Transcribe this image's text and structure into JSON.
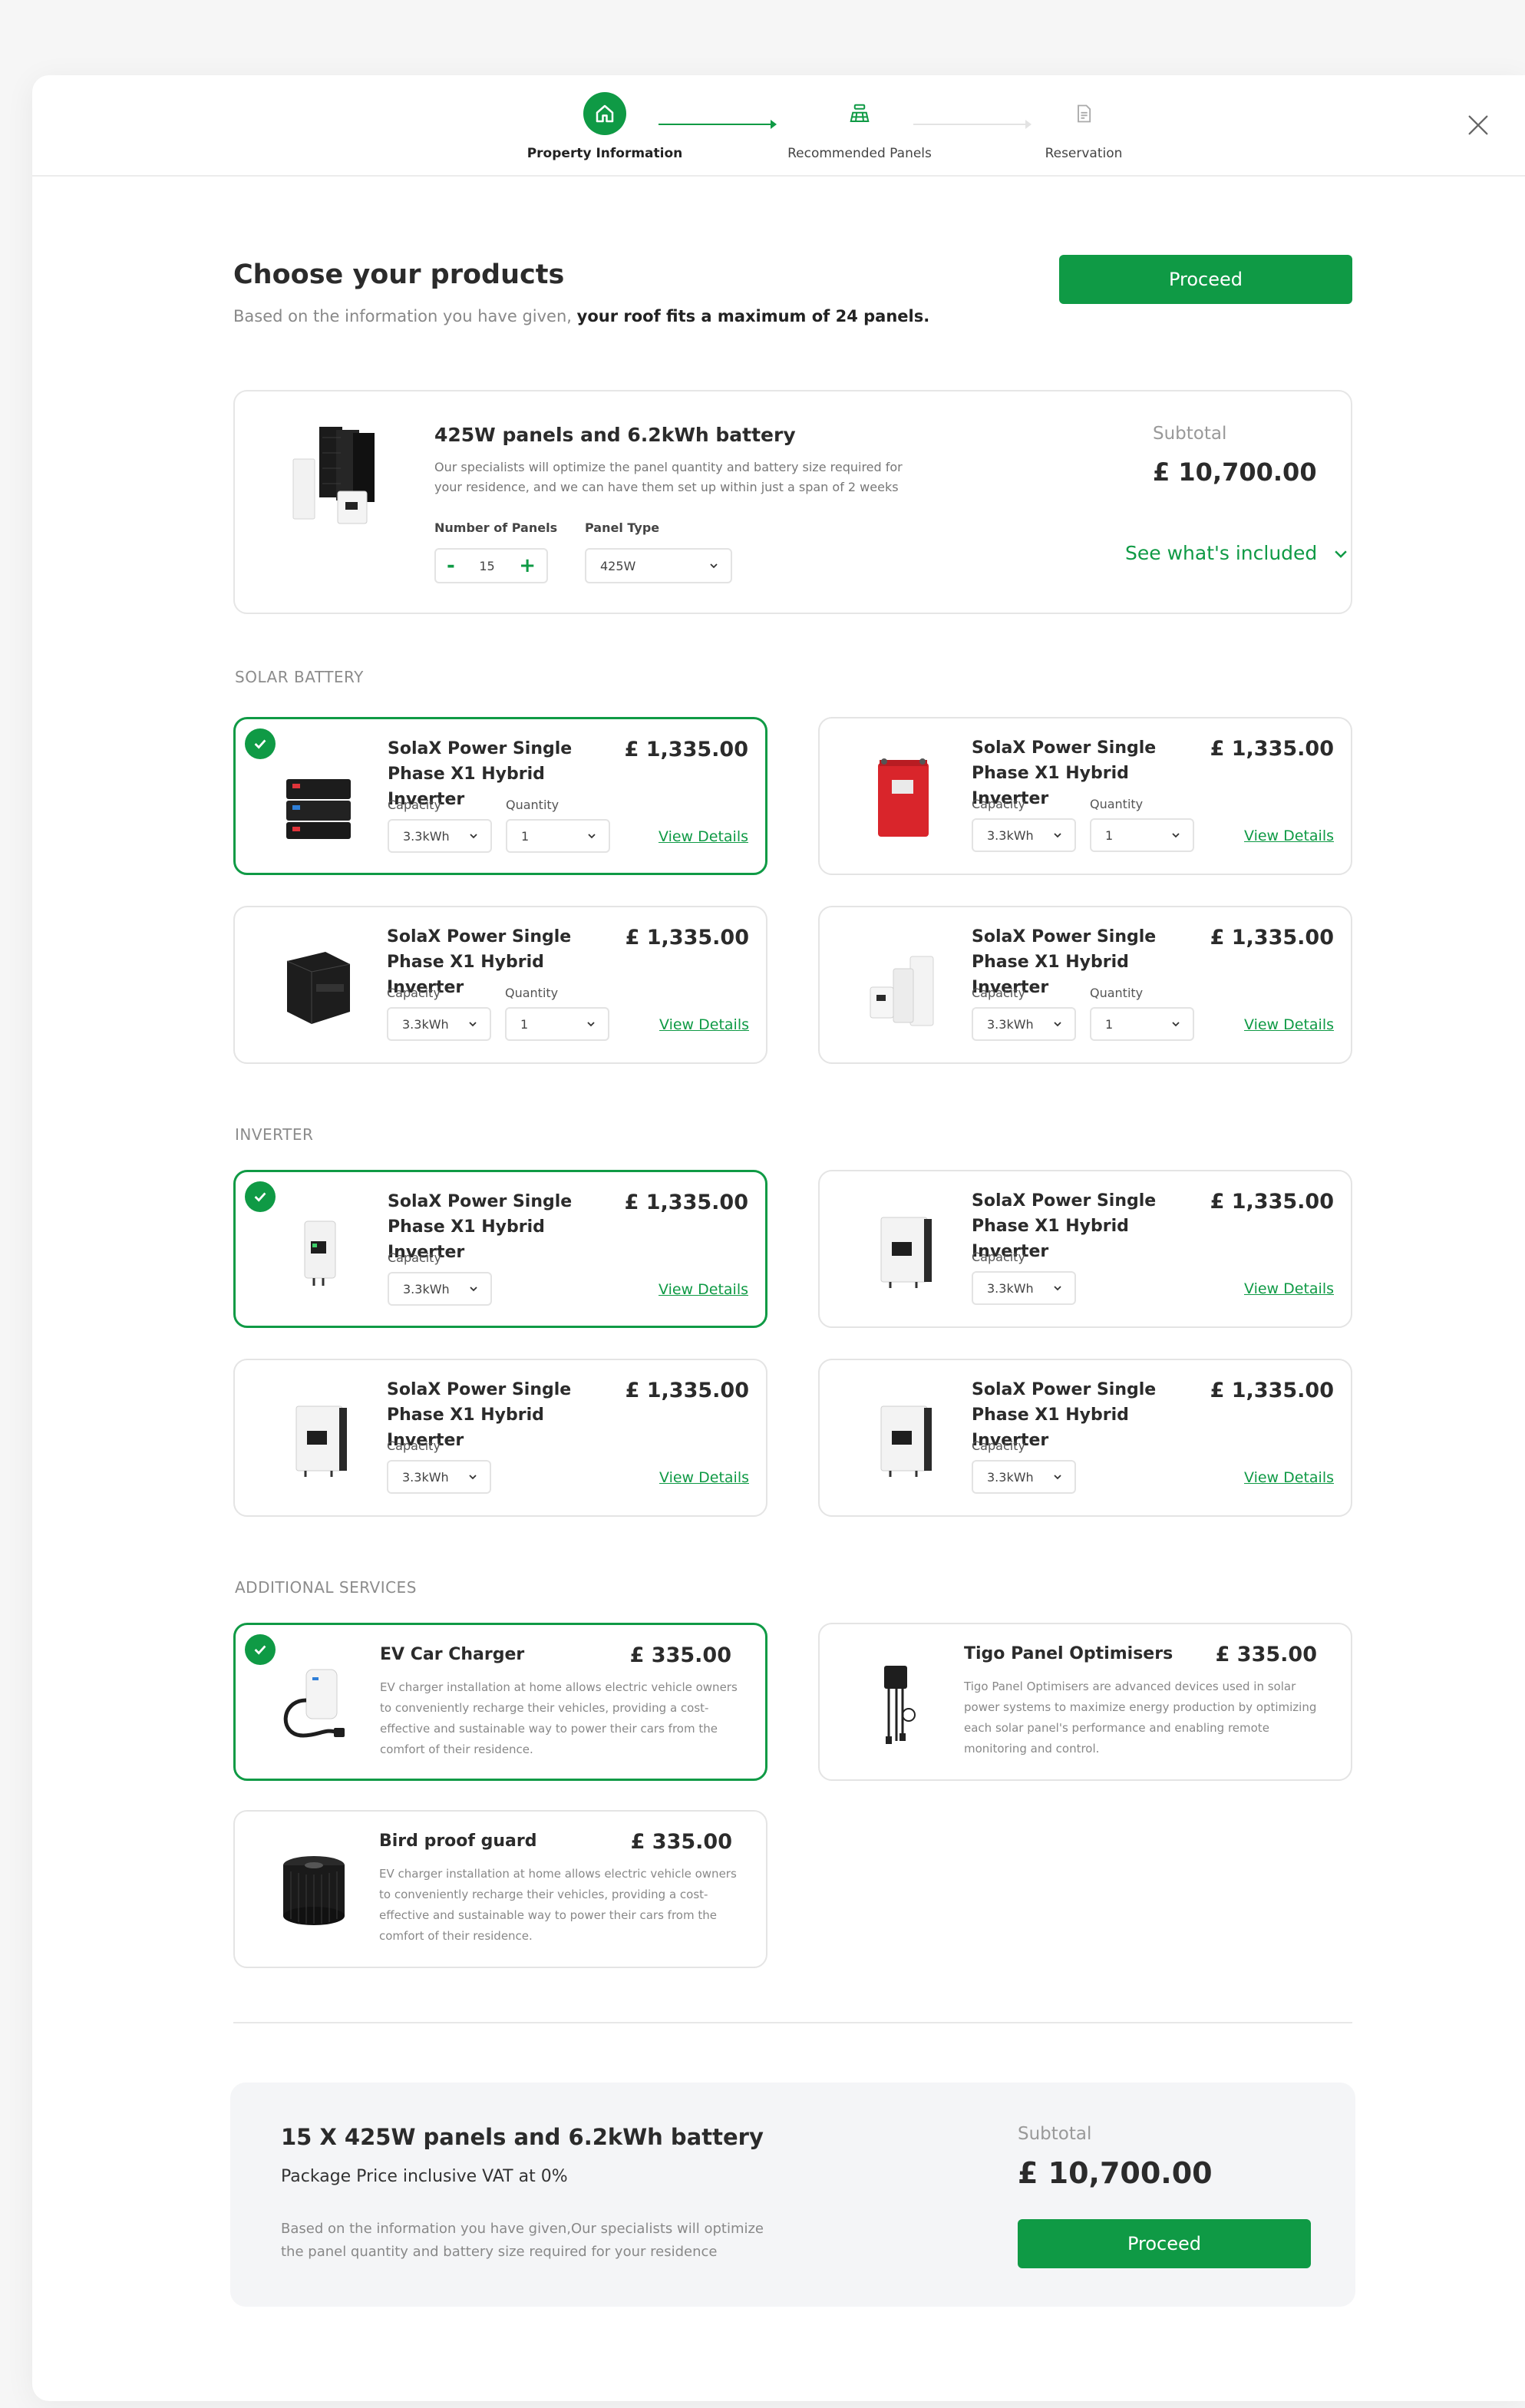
{
  "stepper": {
    "steps": [
      {
        "label": "Property Information"
      },
      {
        "label": "Recommended Panels"
      },
      {
        "label": "Reservation"
      }
    ]
  },
  "header": {
    "title": "Choose your products",
    "subtitle_prefix": "Based on the information you have given, ",
    "subtitle_bold": "your roof fits a maximum of 24 panels.",
    "proceed_label": "Proceed"
  },
  "package": {
    "title": "425W panels and 6.2kWh battery",
    "description": "Our specialists will optimize the panel quantity and battery size required for your residence, and we can have them set up within just a span of 2 weeks",
    "panels_label": "Number of Panels",
    "panels_value": "15",
    "minus": "-",
    "plus": "+",
    "panel_type_label": "Panel Type",
    "panel_type_value": "425W",
    "subtotal_label": "Subtotal",
    "subtotal_value": "£ 10,700.00",
    "see_included": "See what's included"
  },
  "sections": {
    "solar_battery": "SOLAR BATTERY",
    "inverter": "INVERTER",
    "additional_services": "ADDITIONAL SERVICES"
  },
  "product": {
    "name": "SolaX Power Single Phase X1 Hybrid Inverter",
    "price": "£ 1,335.00",
    "capacity_label": "Capacity",
    "capacity_value": "3.3kWh",
    "quantity_label": "Quantity",
    "quantity_value": "1",
    "view_details": "View Details"
  },
  "services": {
    "ev": {
      "name": "EV Car Charger",
      "price": "£ 335.00",
      "desc": "EV charger installation at home allows electric vehicle owners to conveniently recharge their vehicles, providing a cost-effective and sustainable way to power their cars from the comfort of their residence."
    },
    "tigo": {
      "name": "Tigo Panel Optimisers",
      "price": "£ 335.00",
      "desc": "Tigo Panel Optimisers are advanced devices used in solar power systems to maximize energy production by optimizing each solar panel's performance and enabling remote monitoring and control."
    },
    "bird": {
      "name": "Bird proof guard",
      "price": "£ 335.00",
      "desc": "EV charger installation at home allows electric vehicle owners to conveniently recharge their vehicles, providing a cost-effective and sustainable way to power their cars from the comfort of their residence."
    }
  },
  "summary": {
    "title": "15 X 425W panels and 6.2kWh battery",
    "subtitle": "Package Price inclusive VAT at 0%",
    "description": "Based on the information you have given,Our specialists will optimize the panel quantity and battery size required for your residence",
    "subtotal_label": "Subtotal",
    "subtotal_value": "£ 10,700.00",
    "proceed_label": "Proceed"
  },
  "colors": {
    "accent": "#0f9a45",
    "border": "#e4e4e4",
    "summary_bg": "#f4f5f7"
  }
}
